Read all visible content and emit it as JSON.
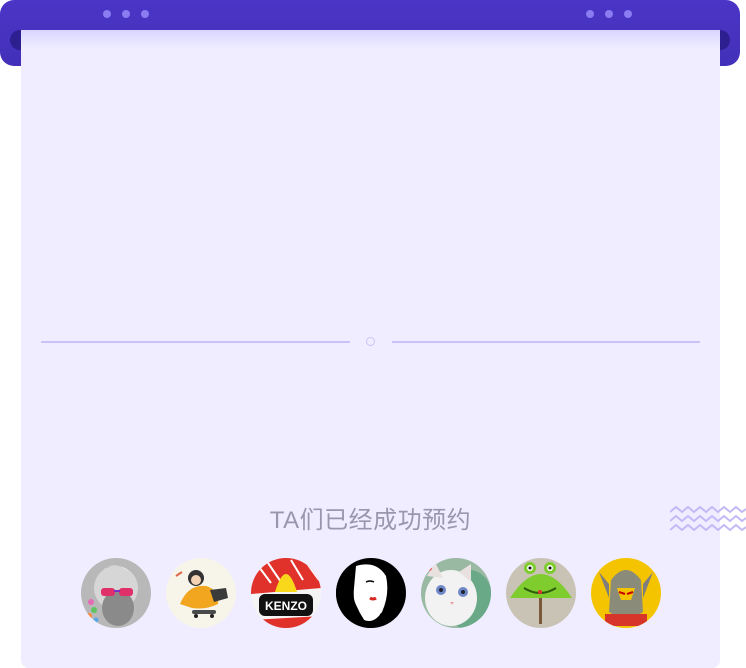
{
  "caption": "TA们已经成功预约",
  "colors": {
    "header": "#4330b8",
    "card": "#efedff",
    "divider": "#cbc3f7",
    "caption": "#9a96ad",
    "zigzag": "#c4b9f5"
  },
  "avatars": [
    {
      "name": "avatar-old-man-sunglasses",
      "icon": "old-man-with-red-sunglasses"
    },
    {
      "name": "avatar-skater-illustration",
      "icon": "skater-in-yellow-jacket"
    },
    {
      "name": "avatar-kenzo",
      "icon": "kenzo-logo",
      "label": "KENZO"
    },
    {
      "name": "avatar-ink-woman",
      "icon": "ink-drawing-woman"
    },
    {
      "name": "avatar-cat",
      "icon": "white-cat-blue-eyes"
    },
    {
      "name": "avatar-frog-umbrella",
      "icon": "green-frog-umbrella"
    },
    {
      "name": "avatar-robot-helmet",
      "icon": "robot-helmet-yellow"
    }
  ]
}
